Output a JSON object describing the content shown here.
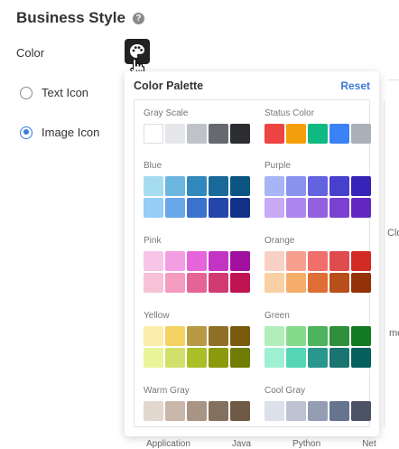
{
  "header": {
    "title": "Business Style",
    "help_icon": "question-circle-icon"
  },
  "color": {
    "label": "Color",
    "trigger_icon": "palette-icon"
  },
  "radios": [
    {
      "label": "Text Icon",
      "selected": false
    },
    {
      "label": "Image Icon",
      "selected": true
    }
  ],
  "palette": {
    "title": "Color Palette",
    "reset_label": "Reset",
    "groups": [
      {
        "label": "Gray Scale",
        "rows": [
          [
            "#ffffff",
            "#e5e7eb",
            "#bfc3c9",
            "#666a70",
            "#2b2d31"
          ]
        ]
      },
      {
        "label": "Status Color",
        "rows": [
          [
            "#ee4444",
            "#f59e0b",
            "#10b981",
            "#3b82f6",
            "#a9b0b8"
          ]
        ]
      },
      {
        "label": "Blue",
        "rows": [
          [
            "#a6dcf2",
            "#6db6e0",
            "#3188bd",
            "#1a6a99",
            "#0b5583"
          ],
          [
            "#94cdf6",
            "#68a7ea",
            "#3b73cc",
            "#2446a8",
            "#123288"
          ]
        ]
      },
      {
        "label": "Purple",
        "rows": [
          [
            "#a8b4f5",
            "#8892ef",
            "#6463df",
            "#4640cc",
            "#3623b8"
          ],
          [
            "#c7a9f4",
            "#ab86ee",
            "#9360e0",
            "#7a40d2",
            "#6328c2"
          ]
        ]
      },
      {
        "label": "Pink",
        "rows": [
          [
            "#f6c5e8",
            "#f29ee3",
            "#e565da",
            "#c235c4",
            "#a1119f"
          ],
          [
            "#f7c2d6",
            "#f39cbf",
            "#e66495",
            "#d23a72",
            "#c01452"
          ]
        ]
      },
      {
        "label": "Orange",
        "rows": [
          [
            "#f9d0c4",
            "#f7a08d",
            "#f06f6a",
            "#e04b4e",
            "#d12b24"
          ],
          [
            "#f9d0a3",
            "#f6ad6a",
            "#df6e35",
            "#b84f1a",
            "#943108"
          ]
        ]
      },
      {
        "label": "Yellow",
        "rows": [
          [
            "#fbeead",
            "#f3d262",
            "#b99a44",
            "#8f6f27",
            "#7a5a0c"
          ],
          [
            "#eaf59b",
            "#d3df6d",
            "#aabf27",
            "#8b9a0c",
            "#6f7d05"
          ]
        ]
      },
      {
        "label": "Green",
        "rows": [
          [
            "#b0eeba",
            "#84db8a",
            "#4db35d",
            "#2f8f3a",
            "#127a20"
          ],
          [
            "#9ef0d2",
            "#55d6b5",
            "#29978d",
            "#1a7470",
            "#05605d"
          ]
        ]
      },
      {
        "label": "Warm Gray",
        "rows": [
          [
            "#e3d8cf",
            "#c8b7aa",
            "#a99584",
            "#84705f",
            "#6f5a48"
          ]
        ]
      },
      {
        "label": "Cool Gray",
        "rows": [
          [
            "#dce0ea",
            "#bcc2d1",
            "#949db4",
            "#677490",
            "#4c5364"
          ]
        ]
      }
    ]
  },
  "background_fragments": {
    "frag_clo": "Clo",
    "frag_me": "me",
    "bottom_tabs": [
      "Application",
      "Java",
      "Python",
      "Net"
    ]
  }
}
